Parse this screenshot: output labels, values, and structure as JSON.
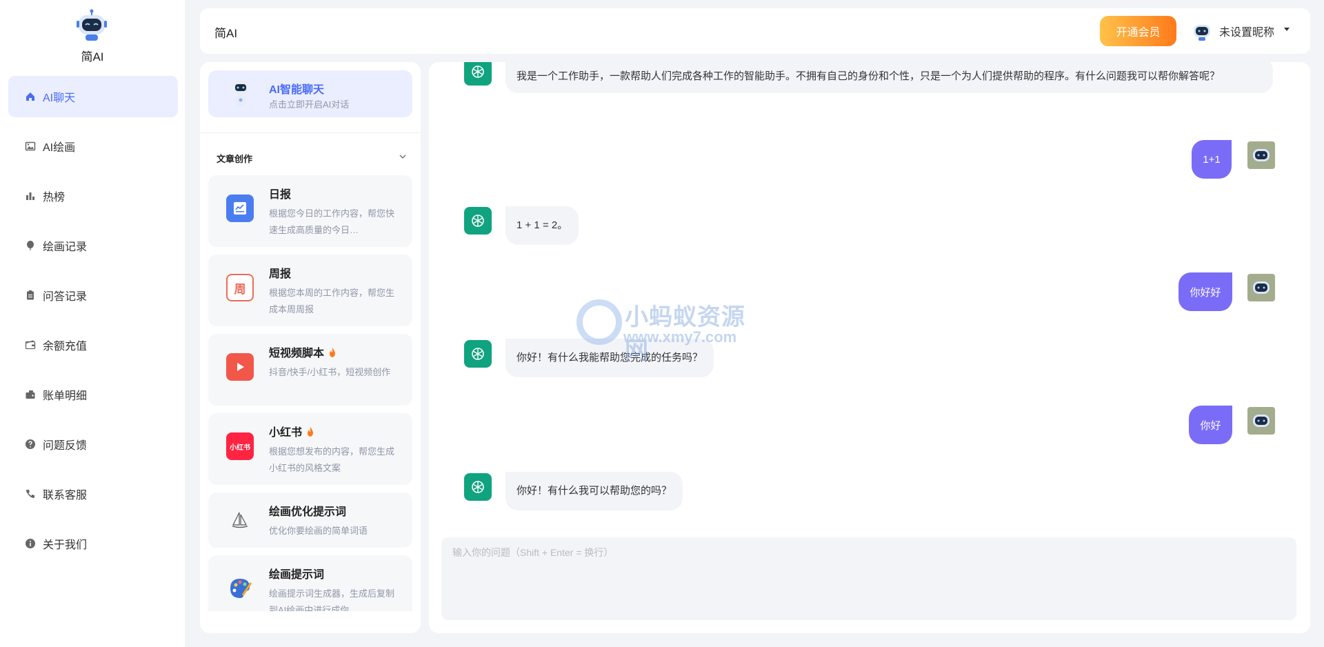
{
  "app": {
    "name": "简AI"
  },
  "sidebar": {
    "items": [
      {
        "label": "AI聊天",
        "icon": "home-icon"
      },
      {
        "label": "AI绘画",
        "icon": "image-icon"
      },
      {
        "label": "热榜",
        "icon": "bar-chart-icon"
      },
      {
        "label": "绘画记录",
        "icon": "balloon-icon"
      },
      {
        "label": "问答记录",
        "icon": "clipboard-icon"
      },
      {
        "label": "余额充值",
        "icon": "wallet-icon"
      },
      {
        "label": "账单明细",
        "icon": "card-icon"
      },
      {
        "label": "问题反馈",
        "icon": "question-icon"
      },
      {
        "label": "联系客服",
        "icon": "phone-icon"
      },
      {
        "label": "关于我们",
        "icon": "info-icon"
      }
    ]
  },
  "header": {
    "title": "简AI",
    "vip_label": "开通会员",
    "user_name": "未设置昵称"
  },
  "panel": {
    "ai_card": {
      "title": "AI智能聊天",
      "subtitle": "点击立即开启AI对话"
    },
    "section_title": "文章创作",
    "cards": [
      {
        "title": "日报",
        "desc": "根据您今日的工作内容，帮您快速生成高质量的今日…",
        "icon": "daily-report-icon"
      },
      {
        "title": "周报",
        "desc": "根据您本周的工作内容，帮您生成本周周报",
        "icon": "weekly-report-icon",
        "icon_text": "周"
      },
      {
        "title": "短视频脚本",
        "desc": "抖音/快手/小红书，短视频创作",
        "icon": "video-icon",
        "hot": true
      },
      {
        "title": "小红书",
        "desc": "根据您想发布的内容，帮您生成小红书的风格文案",
        "icon": "xiaohongshu-icon",
        "icon_text": "小红书",
        "hot": true
      },
      {
        "title": "绘画优化提示词",
        "desc": "优化你要绘画的简单词语",
        "icon": "sailboat-icon"
      },
      {
        "title": "绘画提示词",
        "desc": "绘画提示词生成器，生成后复制到AI绘画中进行成你",
        "icon": "palette-icon"
      }
    ]
  },
  "chat": {
    "messages": [
      {
        "role": "bot",
        "text": "我是一个工作助手，一款帮助人们完成各种工作的智能助手。不拥有自己的身份和个性，只是一个为人们提供帮助的程序。有什么问题我可以帮你解答呢？"
      },
      {
        "role": "user",
        "text": "1+1"
      },
      {
        "role": "bot",
        "text": "1 + 1 = 2。"
      },
      {
        "role": "user",
        "text": "你好好"
      },
      {
        "role": "bot",
        "text": "你好！有什么我能帮助您完成的任务吗？"
      },
      {
        "role": "user",
        "text": "你好"
      },
      {
        "role": "bot",
        "text": "你好！有什么我可以帮助您的吗？"
      }
    ],
    "input_placeholder": "输入你的问题（Shift + Enter = 换行）"
  },
  "watermark": {
    "line1": "小蚂蚁资源网",
    "line2": "www.xmy7.com"
  },
  "colors": {
    "accent": "#4a6cf7",
    "user_bubble": "#7b6cf8",
    "bot_avatar": "#10a37f",
    "vip_from": "#ffc24a",
    "vip_to": "#ff7a1a"
  }
}
